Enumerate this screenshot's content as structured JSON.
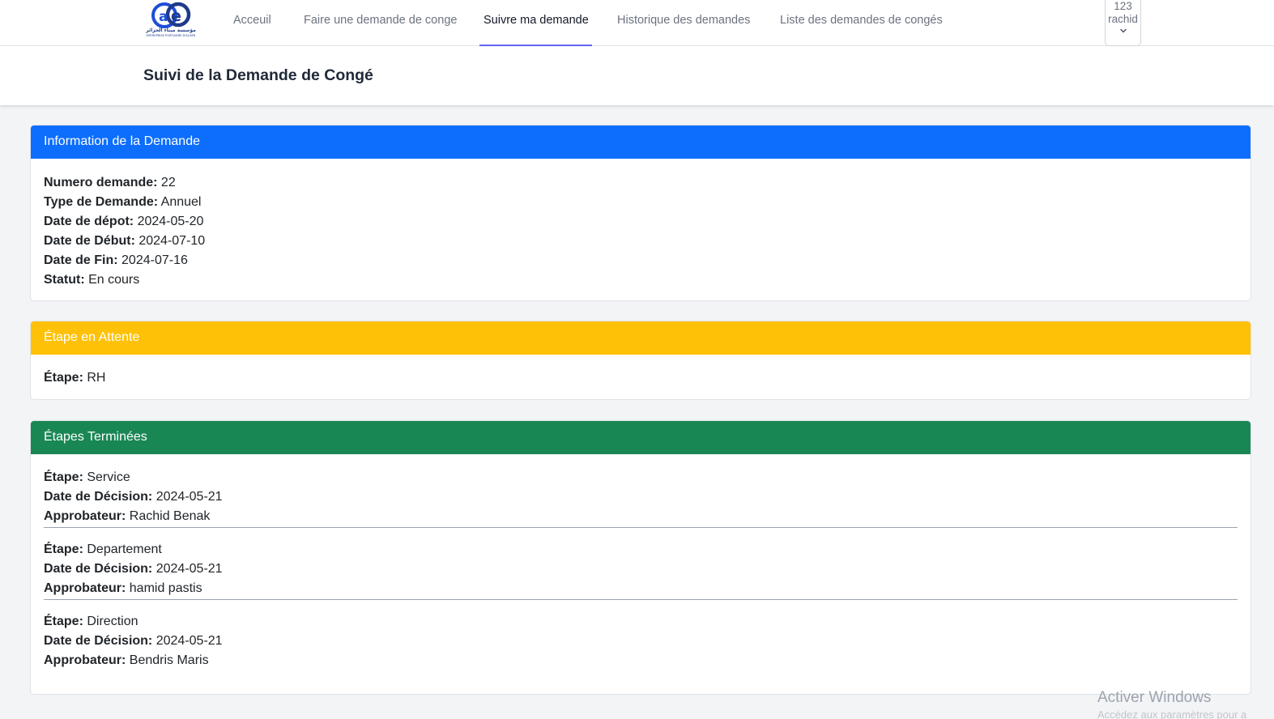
{
  "nav": {
    "logo_text": "مؤسسة ميناء الجزائر",
    "logo_subtext": "ENTREPRISE PORTUAIRE D'ALGER",
    "links": [
      "Acceuil",
      "Faire une demande de conge",
      "Suivre ma demande",
      "Historique des demandes",
      "Liste des demandes de congés"
    ],
    "active": "Suivre ma demande",
    "user": {
      "id": "123",
      "name": "rachid"
    }
  },
  "page_title": "Suivi de la Demande de Congé",
  "info_card": {
    "title": "Information de la Demande",
    "color": "#0d6efd",
    "fields": [
      {
        "label": "Numero demande:",
        "value": "22"
      },
      {
        "label": "Type de Demande:",
        "value": "Annuel"
      },
      {
        "label": "Date de dépot:",
        "value": "2024-05-20"
      },
      {
        "label": "Date de Début:",
        "value": "2024-07-10"
      },
      {
        "label": "Date de Fin:",
        "value": "2024-07-16"
      },
      {
        "label": "Statut:",
        "value": "En cours"
      }
    ]
  },
  "pending_card": {
    "title": "Étape en Attente",
    "color": "#ffc107",
    "label": "Étape:",
    "value": "RH"
  },
  "done_card": {
    "title": "Étapes Terminées",
    "color": "#198754",
    "labels": {
      "step": "Étape:",
      "date": "Date de Décision:",
      "approver": "Approbateur:"
    },
    "steps": [
      {
        "step": "Service",
        "date": "2024-05-21",
        "approver": "Rachid Benak"
      },
      {
        "step": "Departement",
        "date": "2024-05-21",
        "approver": "hamid pastis"
      },
      {
        "step": "Direction",
        "date": "2024-05-21",
        "approver": "Bendris Maris"
      }
    ]
  },
  "watermark": {
    "title": "Activer Windows",
    "subtitle": "Accédez aux paramètres pour a"
  }
}
